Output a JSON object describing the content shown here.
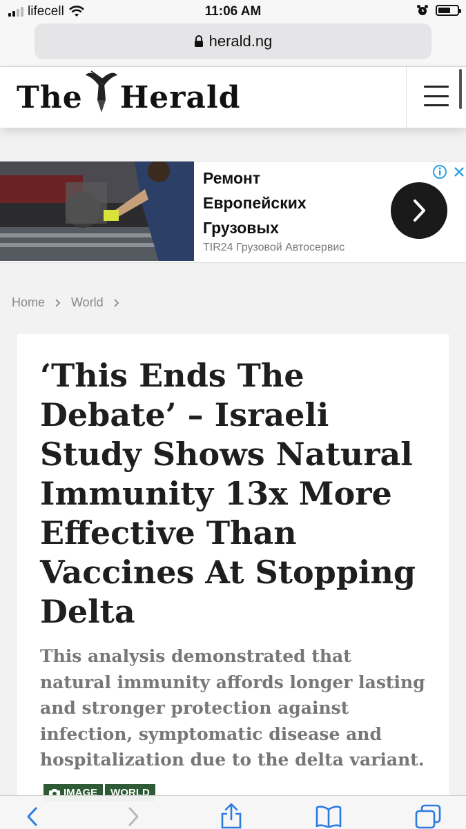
{
  "status_bar": {
    "carrier": "lifecell",
    "time": "11:06 AM"
  },
  "browser": {
    "url": "herald.ng"
  },
  "site": {
    "logo_text_left": "The",
    "logo_text_right": "Herald"
  },
  "ad": {
    "title": "Ремонт\nЕвропейских\nГрузовых",
    "source": "TIR24 Грузовой Автосервис"
  },
  "breadcrumb": {
    "home": "Home",
    "section": "World"
  },
  "article": {
    "headline": "‘This Ends The Debate’ – Israeli Study Shows Natural Immunity 13x More Effective Than Vaccines At Stopping Delta",
    "excerpt": "This analysis demonstrated that natural immunity affords longer lasting and stronger protection against infection, symptomatic disease and hospitalization due to the delta variant.",
    "tags": [
      "IMAGE",
      "WORLD"
    ]
  },
  "colors": {
    "tag_bg": "#2e5a35",
    "ad_button": "#1a1a1a",
    "info_icon": "#29a1e0"
  }
}
